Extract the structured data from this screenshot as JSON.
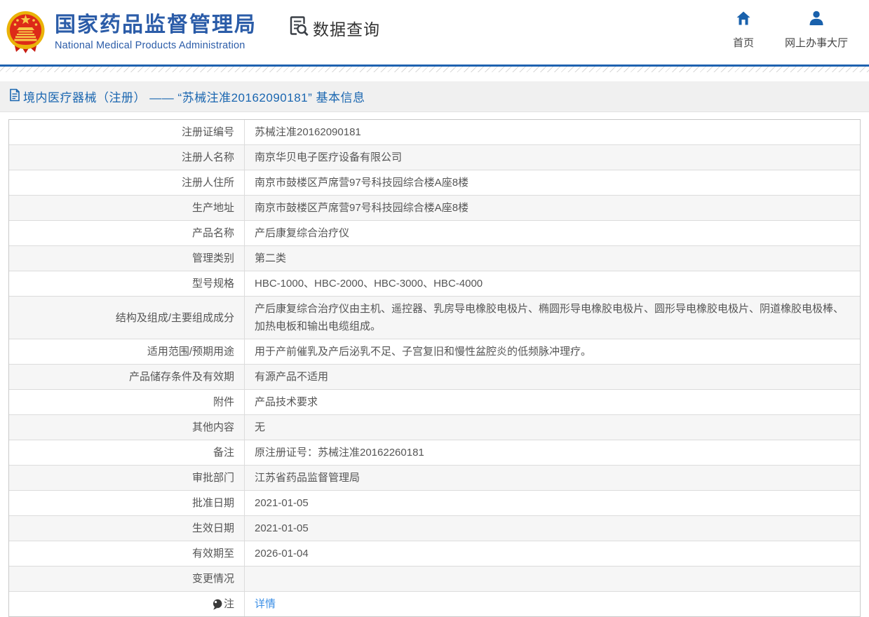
{
  "header": {
    "title_cn": "国家药品监督管理局",
    "title_en": "National Medical Products Administration",
    "section_label": "数据查询",
    "nav": {
      "home": "首页",
      "service_hall": "网上办事大厅"
    }
  },
  "breadcrumb": {
    "text": "境内医疗器械（注册） —— “苏械注准20162090181” 基本信息"
  },
  "table": {
    "rows": [
      {
        "label": "注册证编号",
        "value": "苏械注准20162090181"
      },
      {
        "label": "注册人名称",
        "value": "南京华贝电子医疗设备有限公司"
      },
      {
        "label": "注册人住所",
        "value": "南京市鼓楼区芦席营97号科技园综合楼A座8楼"
      },
      {
        "label": "生产地址",
        "value": "南京市鼓楼区芦席营97号科技园综合楼A座8楼"
      },
      {
        "label": "产品名称",
        "value": "产后康复综合治疗仪"
      },
      {
        "label": "管理类别",
        "value": "第二类"
      },
      {
        "label": "型号规格",
        "value": "HBC-1000、HBC-2000、HBC-3000、HBC-4000"
      },
      {
        "label": "结构及组成/主要组成成分",
        "value": "产后康复综合治疗仪由主机、遥控器、乳房导电橡胶电极片、椭圆形导电橡胶电极片、圆形导电橡胶电极片、阴道橡胶电极棒、加热电板和输出电缆组成。"
      },
      {
        "label": "适用范围/预期用途",
        "value": "用于产前催乳及产后泌乳不足、子宫复旧和慢性盆腔炎的低频脉冲理疗。"
      },
      {
        "label": "产品储存条件及有效期",
        "value": "有源产品不适用"
      },
      {
        "label": "附件",
        "value": "产品技术要求"
      },
      {
        "label": "其他内容",
        "value": "无"
      },
      {
        "label": "备注",
        "value": "原注册证号：苏械注准20162260181"
      },
      {
        "label": "审批部门",
        "value": "江苏省药品监督管理局"
      },
      {
        "label": "批准日期",
        "value": "2021-01-05"
      },
      {
        "label": "生效日期",
        "value": "2021-01-05"
      },
      {
        "label": "有效期至",
        "value": "2026-01-04"
      },
      {
        "label": "变更情况",
        "value": ""
      },
      {
        "label": "注",
        "label_icon": "bulb-icon",
        "value": "详情",
        "link": true
      }
    ]
  },
  "colors": {
    "brand_blue": "#2b5ca8",
    "divider_blue": "#1e62b0",
    "link_blue": "#3a8ee6",
    "nav_icon_blue": "#1961ac",
    "emblem_red": "#dd2a18",
    "emblem_gold": "#eab308",
    "row_alt_bg": "#f6f6f6",
    "breadcrumb_bg": "#f0f0f0",
    "breadcrumb_text": "#1a66b0",
    "table_border": "#c9c9c9",
    "cell_text": "#555555"
  }
}
